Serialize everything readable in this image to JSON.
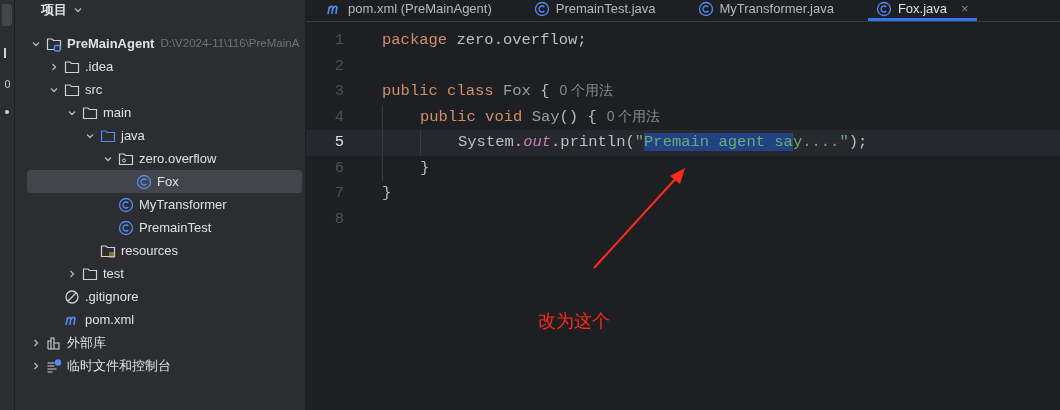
{
  "project_panel": {
    "title": "项目",
    "tree": [
      {
        "kind": "module",
        "label": "PreMainAgent",
        "path": "D:\\V2024-11\\116\\PreMainA",
        "expanded": true,
        "selected": false,
        "children": [
          {
            "kind": "folder",
            "label": ".idea",
            "expanded": false,
            "selected": false
          },
          {
            "kind": "folder",
            "label": "src",
            "expanded": true,
            "selected": false,
            "children": [
              {
                "kind": "folder",
                "label": "main",
                "expanded": true,
                "selected": false,
                "children": [
                  {
                    "kind": "source",
                    "label": "java",
                    "expanded": true,
                    "selected": false,
                    "children": [
                      {
                        "kind": "package",
                        "label": "zero.overflow",
                        "expanded": true,
                        "selected": false,
                        "children": [
                          {
                            "kind": "class",
                            "label": "Fox",
                            "selected": true
                          }
                        ]
                      },
                      {
                        "kind": "class",
                        "label": "MyTransformer",
                        "selected": false
                      },
                      {
                        "kind": "class",
                        "label": "PremainTest",
                        "selected": false
                      }
                    ]
                  },
                  {
                    "kind": "resources",
                    "label": "resources",
                    "selected": false
                  }
                ]
              },
              {
                "kind": "folder",
                "label": "test",
                "expanded": false,
                "selected": false
              }
            ]
          },
          {
            "kind": "gitignore",
            "label": ".gitignore",
            "selected": false
          },
          {
            "kind": "maven",
            "label": "pom.xml",
            "selected": false
          }
        ]
      },
      {
        "kind": "library",
        "label": "外部库",
        "expanded": false,
        "selected": false
      },
      {
        "kind": "scratch",
        "label": "临时文件和控制台",
        "expanded": false,
        "selected": false
      }
    ]
  },
  "tabs": [
    {
      "kind": "maven",
      "label": "pom.xml (PreMainAgent)",
      "selected": false
    },
    {
      "kind": "class",
      "label": "PremainTest.java",
      "selected": false
    },
    {
      "kind": "class",
      "label": "MyTransformer.java",
      "selected": false
    },
    {
      "kind": "class",
      "label": "Fox.java",
      "selected": true,
      "close": "×"
    }
  ],
  "editor": {
    "lines": [
      {
        "number": "1",
        "current": false,
        "tokens": [
          {
            "kind": "keyword",
            "text": "package "
          },
          {
            "kind": "plain",
            "text": "zero.overflow;"
          }
        ]
      },
      {
        "number": "2",
        "current": false
      },
      {
        "number": "3",
        "current": false,
        "tokens": [
          {
            "kind": "keyword",
            "text": "public class "
          },
          {
            "kind": "type",
            "text": "Fox "
          },
          {
            "kind": "plain",
            "text": "{"
          },
          {
            "kind": "hint",
            "text": "0 个用法"
          }
        ]
      },
      {
        "number": "4",
        "current": false,
        "kind": "class",
        "tokens": [
          {
            "kind": "keyword",
            "text": "public void "
          },
          {
            "kind": "type",
            "text": "Say"
          },
          {
            "kind": "plain",
            "text": "() {"
          },
          {
            "kind": "hint",
            "text": "0 个用法"
          }
        ]
      },
      {
        "number": "5",
        "current": true,
        "kind": "method",
        "tokens": [
          {
            "kind": "plain",
            "text": "System."
          },
          {
            "kind": "field",
            "text": "out"
          },
          {
            "kind": "plain",
            "text": ".println("
          },
          {
            "kind": "string",
            "text": "\"",
            "selected": false
          },
          {
            "kind": "string",
            "text": "Premain agent sa",
            "selected": true
          },
          {
            "kind": "string",
            "text": "y....\"",
            "selected": false
          },
          {
            "kind": "plain",
            "text": ");"
          }
        ]
      },
      {
        "number": "6",
        "current": false,
        "kind": "class",
        "tokens": [
          {
            "kind": "plain",
            "text": "}"
          }
        ]
      },
      {
        "number": "7",
        "current": false,
        "tokens": [
          {
            "kind": "plain",
            "text": "}"
          }
        ]
      },
      {
        "number": "8",
        "current": false
      }
    ]
  },
  "annotation": {
    "text": "改为这个",
    "color": "#ff2a1a"
  }
}
